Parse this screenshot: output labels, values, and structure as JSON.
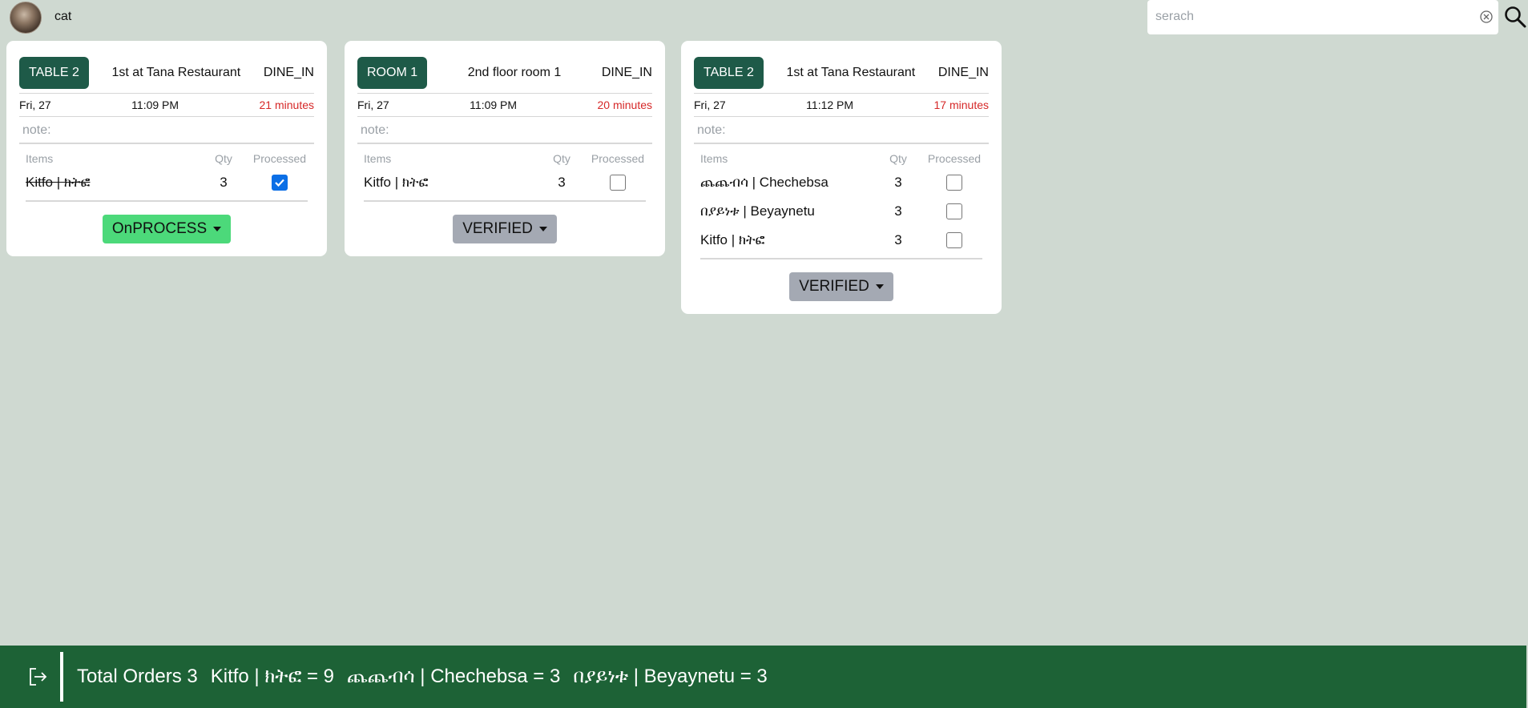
{
  "user": {
    "name": "cat"
  },
  "search": {
    "placeholder": "serach",
    "value": ""
  },
  "orders": [
    {
      "tag": "TABLE 2",
      "location": "1st at Tana Restaurant",
      "order_type": "DINE_IN",
      "day": "Fri, 27",
      "time": "11:09 PM",
      "elapsed": "21 minutes",
      "note_label": "note:",
      "headers": {
        "items": "Items",
        "qty": "Qty",
        "processed": "Processed"
      },
      "items": [
        {
          "name": "Kitfo | ክትፎ",
          "qty": "3",
          "processed": true
        }
      ],
      "status": "OnPROCESS"
    },
    {
      "tag": "ROOM 1",
      "location": "2nd floor room 1",
      "order_type": "DINE_IN",
      "day": "Fri, 27",
      "time": "11:09 PM",
      "elapsed": "20 minutes",
      "note_label": "note:",
      "headers": {
        "items": "Items",
        "qty": "Qty",
        "processed": "Processed"
      },
      "items": [
        {
          "name": "Kitfo | ክትፎ",
          "qty": "3",
          "processed": false
        }
      ],
      "status": "VERIFIED"
    },
    {
      "tag": "TABLE 2",
      "location": "1st at Tana Restaurant",
      "order_type": "DINE_IN",
      "day": "Fri, 27",
      "time": "11:12 PM",
      "elapsed": "17 minutes",
      "note_label": "note:",
      "headers": {
        "items": "Items",
        "qty": "Qty",
        "processed": "Processed"
      },
      "items": [
        {
          "name": "ጨጨብሳ | Chechebsa",
          "qty": "3",
          "processed": false
        },
        {
          "name": "በያይነቱ | Beyaynetu",
          "qty": "3",
          "processed": false
        },
        {
          "name": "Kitfo | ክትፎ",
          "qty": "3",
          "processed": false
        }
      ],
      "status": "VERIFIED"
    }
  ],
  "footer": {
    "total": "Total Orders 3",
    "summary": [
      "Kitfo | ክትፎ = 9",
      "ጨጨብሳ | Chechebsa = 3",
      "በያይነቱ | Beyaynetu = 3"
    ]
  },
  "colors": {
    "background": "#cfd9d1",
    "tag": "#1e5a48",
    "onprocess": "#4cd97a",
    "verified": "#a4a9b3",
    "elapsed": "#d62828",
    "footer": "#1d6236",
    "checkbox_checked": "#0b6fe6"
  },
  "icons": {
    "clear": "clear-circle-icon",
    "search": "search-icon",
    "logout": "logout-icon",
    "status_caret": "caret-down-icon"
  }
}
